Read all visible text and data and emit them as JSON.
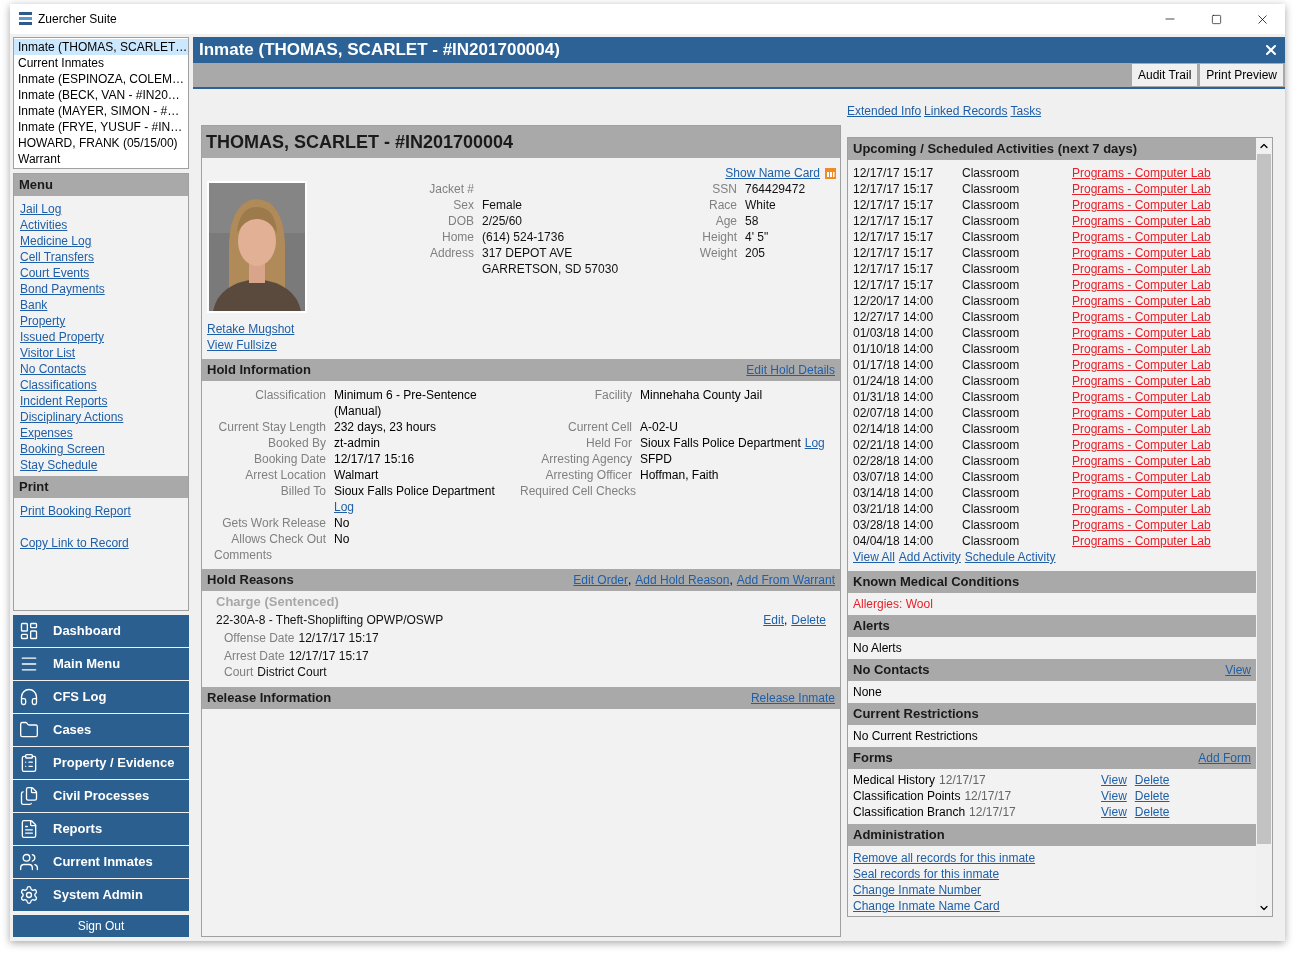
{
  "window": {
    "title": "Zuercher Suite"
  },
  "recent_tabs": [
    {
      "label": "Inmate (THOMAS, SCARLET…",
      "selected": true
    },
    {
      "label": "Current Inmates",
      "selected": false
    },
    {
      "label": "Inmate (ESPINOZA, COLEM…",
      "selected": false
    },
    {
      "label": "Inmate (BECK, VAN - #IN20…",
      "selected": false
    },
    {
      "label": "Inmate (MAYER, SIMON - #…",
      "selected": false
    },
    {
      "label": "Inmate (FRYE, YUSUF - #IN…",
      "selected": false
    },
    {
      "label": "HOWARD, FRANK (05/15/00)",
      "selected": false
    },
    {
      "label": "Warrant",
      "selected": false
    }
  ],
  "menu": {
    "title": "Menu",
    "links": [
      "Jail Log",
      "Activities",
      "Medicine Log",
      "Cell Transfers",
      "Court Events",
      "Bond Payments",
      "Bank",
      "Property",
      "Issued Property",
      "Visitor List",
      "No Contacts",
      "Classifications",
      "Incident Reports",
      "Disciplinary Actions",
      "Expenses",
      "Booking Screen",
      "Stay Schedule"
    ]
  },
  "print": {
    "title": "Print",
    "links": [
      "Print Booking Report",
      "Copy Link to Record"
    ]
  },
  "nav": [
    "Dashboard",
    "Main Menu",
    "CFS Log",
    "Cases",
    "Property / Evidence",
    "Civil Processes",
    "Reports",
    "Current Inmates",
    "System Admin"
  ],
  "sign_out": "Sign Out",
  "record": {
    "title": "Inmate (THOMAS, SCARLET - #IN201700004)",
    "toolbar": [
      "Audit Trail",
      "Print Preview"
    ]
  },
  "inmate": {
    "heading": "THOMAS, SCARLET - #IN201700004",
    "show_name_card": "Show Name Card",
    "photo_links": [
      "Retake Mugshot",
      "View Fullsize"
    ],
    "fields_left": [
      {
        "label": "Jacket #"
      },
      {
        "label": "Sex",
        "value": "Female"
      },
      {
        "label": "DOB",
        "value": "2/25/60"
      },
      {
        "label": "Home",
        "value": "(614) 524-1736"
      },
      {
        "label": "Address",
        "value": "317 DEPOT AVE\nGARRETSON, SD 57030"
      }
    ],
    "fields_right": [
      {
        "label": "SSN",
        "value": "764429472"
      },
      {
        "label": "Race",
        "value": "White"
      },
      {
        "label": "Age",
        "value": "58"
      },
      {
        "label": "Height",
        "value": "4' 5\""
      },
      {
        "label": "Weight",
        "value": "205"
      }
    ]
  },
  "hold_information": {
    "title": "Hold Information",
    "action": "Edit Hold Details",
    "fields_left": [
      {
        "label": "Classification",
        "value": "Minimum 6 - Pre-Sentence\n(Manual)"
      },
      {
        "label": "Current Stay Length",
        "value": "232 days, 23 hours"
      },
      {
        "label": "Booked By",
        "value": "zt-admin"
      },
      {
        "label": "Booking Date",
        "value": "12/17/17 15:16"
      },
      {
        "label": "Arrest Location",
        "value": "Walmart"
      },
      {
        "label": "Billed To",
        "value": "Sioux Falls Police Department",
        "link": "Log"
      },
      {
        "label": "Gets Work Release",
        "value": "No"
      },
      {
        "label": "Allows Check Out",
        "value": "No"
      }
    ],
    "comments_label": "Comments",
    "fields_right": [
      {
        "label": "Facility",
        "value": "Minnehaha County Jail"
      },
      {
        "label": "Current Cell",
        "value": "A-02-U"
      },
      {
        "label": "Held For",
        "value": "Sioux Falls Police Department",
        "link": "Log"
      },
      {
        "label": "Arresting Agency",
        "value": "SFPD"
      },
      {
        "label": "Arresting Officer",
        "value": "Hoffman, Faith"
      },
      {
        "label": "Required Cell Checks"
      }
    ]
  },
  "hold_reasons": {
    "title": "Hold Reasons",
    "actions": [
      "Edit Order",
      "Add Hold Reason",
      "Add From Warrant"
    ],
    "separator": ",",
    "charge_status": "Charge (Sentenced)",
    "charge": "22-30A-8 - Theft-Shoplifting OPWP/OSWP",
    "charge_actions": [
      "Edit",
      "Delete"
    ],
    "details": [
      {
        "label": "Offense Date",
        "value": "12/17/17 15:17"
      },
      {
        "label": "Arrest Date",
        "value": "12/17/17 15:17"
      },
      {
        "label": "Court",
        "value": "District Court"
      }
    ]
  },
  "release_information": {
    "title": "Release Information",
    "action": "Release Inmate"
  },
  "side_links": [
    "Extended Info",
    "Linked Records",
    "Tasks"
  ],
  "activities": {
    "title": "Upcoming / Scheduled Activities (next 7 days)",
    "rows": [
      {
        "date": "12/17/17 15:17",
        "location": "Classroom",
        "program": "Programs - Computer Lab"
      },
      {
        "date": "12/17/17 15:17",
        "location": "Classroom",
        "program": "Programs - Computer Lab"
      },
      {
        "date": "12/17/17 15:17",
        "location": "Classroom",
        "program": "Programs - Computer Lab"
      },
      {
        "date": "12/17/17 15:17",
        "location": "Classroom",
        "program": "Programs - Computer Lab"
      },
      {
        "date": "12/17/17 15:17",
        "location": "Classroom",
        "program": "Programs - Computer Lab"
      },
      {
        "date": "12/17/17 15:17",
        "location": "Classroom",
        "program": "Programs - Computer Lab"
      },
      {
        "date": "12/17/17 15:17",
        "location": "Classroom",
        "program": "Programs - Computer Lab"
      },
      {
        "date": "12/17/17 15:17",
        "location": "Classroom",
        "program": "Programs - Computer Lab"
      },
      {
        "date": "12/20/17 14:00",
        "location": "Classroom",
        "program": "Programs - Computer Lab"
      },
      {
        "date": "12/27/17 14:00",
        "location": "Classroom",
        "program": "Programs - Computer Lab"
      },
      {
        "date": "01/03/18 14:00",
        "location": "Classroom",
        "program": "Programs - Computer Lab"
      },
      {
        "date": "01/10/18 14:00",
        "location": "Classroom",
        "program": "Programs - Computer Lab"
      },
      {
        "date": "01/17/18 14:00",
        "location": "Classroom",
        "program": "Programs - Computer Lab"
      },
      {
        "date": "01/24/18 14:00",
        "location": "Classroom",
        "program": "Programs - Computer Lab"
      },
      {
        "date": "01/31/18 14:00",
        "location": "Classroom",
        "program": "Programs - Computer Lab"
      },
      {
        "date": "02/07/18 14:00",
        "location": "Classroom",
        "program": "Programs - Computer Lab"
      },
      {
        "date": "02/14/18 14:00",
        "location": "Classroom",
        "program": "Programs - Computer Lab"
      },
      {
        "date": "02/21/18 14:00",
        "location": "Classroom",
        "program": "Programs - Computer Lab"
      },
      {
        "date": "02/28/18 14:00",
        "location": "Classroom",
        "program": "Programs - Computer Lab"
      },
      {
        "date": "03/07/18 14:00",
        "location": "Classroom",
        "program": "Programs - Computer Lab"
      },
      {
        "date": "03/14/18 14:00",
        "location": "Classroom",
        "program": "Programs - Computer Lab"
      },
      {
        "date": "03/21/18 14:00",
        "location": "Classroom",
        "program": "Programs - Computer Lab"
      },
      {
        "date": "03/28/18 14:00",
        "location": "Classroom",
        "program": "Programs - Computer Lab"
      },
      {
        "date": "04/04/18 14:00",
        "location": "Classroom",
        "program": "Programs - Computer Lab"
      }
    ],
    "links": [
      "View All",
      "Add Activity",
      "Schedule Activity"
    ]
  },
  "medical": {
    "title": "Known Medical Conditions",
    "items": [
      "Allergies: Wool"
    ]
  },
  "alerts": {
    "title": "Alerts",
    "text": "No Alerts"
  },
  "no_contacts": {
    "title": "No Contacts",
    "action": "View",
    "text": "None"
  },
  "restrictions": {
    "title": "Current Restrictions",
    "text": "No Current Restrictions"
  },
  "forms": {
    "title": "Forms",
    "action": "Add Form",
    "rows": [
      {
        "name": "Medical History",
        "date": "12/17/17",
        "actions": [
          "View",
          "Delete"
        ]
      },
      {
        "name": "Classification Points",
        "date": "12/17/17",
        "actions": [
          "View",
          "Delete"
        ]
      },
      {
        "name": "Classification Branch",
        "date": "12/17/17",
        "actions": [
          "View",
          "Delete"
        ]
      }
    ]
  },
  "administration": {
    "title": "Administration",
    "links": [
      "Remove all records for this inmate",
      "Seal records for this inmate",
      "Change Inmate Number",
      "Change Inmate Name Card"
    ]
  }
}
